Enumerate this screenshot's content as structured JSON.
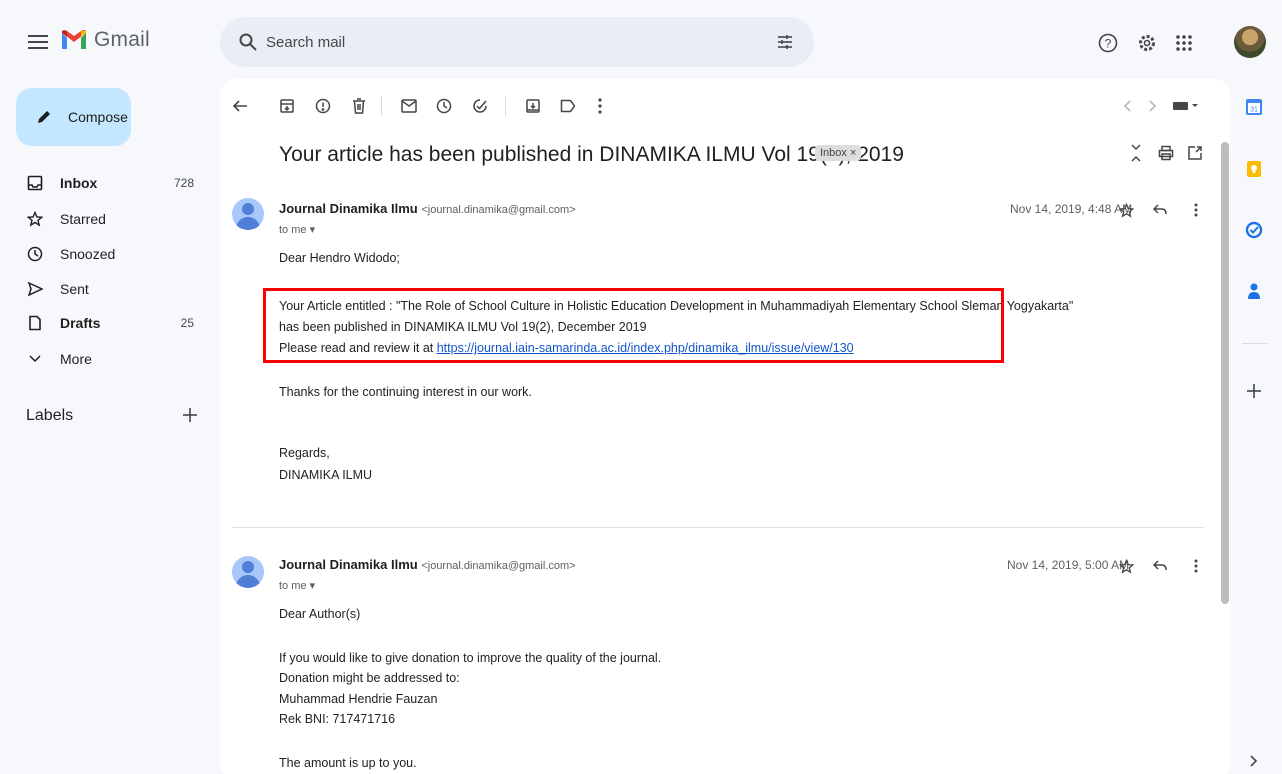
{
  "app": {
    "name": "Gmail"
  },
  "search": {
    "placeholder": "Search mail"
  },
  "compose": {
    "label": "Compose"
  },
  "sidebar": {
    "items": [
      {
        "label": "Inbox",
        "count": "728",
        "icon": "inbox-icon"
      },
      {
        "label": "Starred",
        "count": "",
        "icon": "star-icon"
      },
      {
        "label": "Snoozed",
        "count": "",
        "icon": "clock-icon"
      },
      {
        "label": "Sent",
        "count": "",
        "icon": "send-icon"
      },
      {
        "label": "Drafts",
        "count": "25",
        "icon": "file-icon"
      },
      {
        "label": "More",
        "count": "",
        "icon": "chevron-down-icon"
      }
    ],
    "labels_title": "Labels"
  },
  "thread": {
    "subject": "Your article has been published in DINAMIKA ILMU Vol 19(2), 2019",
    "label_chip": "Inbox ×"
  },
  "messages": [
    {
      "sender_name": "Journal Dinamika Ilmu",
      "sender_email": "<journal.dinamika@gmail.com>",
      "to": "to me ▾",
      "date": "Nov 14, 2019, 4:48 AM",
      "greeting": "Dear Hendro Widodo;",
      "line1": "Your Article entitled : \"The Role of School Culture in Holistic Education Development in Muhammadiyah Elementary School Sleman Yogyakarta\"",
      "line2": "has been published in DINAMIKA ILMU Vol 19(2), December 2019",
      "line3_prefix": "Please read and review it at ",
      "link": "https://journal.iain-samarinda.ac.id/index.php/dinamika_ilmu/issue/view/130",
      "thanks": "Thanks for the continuing interest in our work.",
      "regards": "Regards,",
      "signature": "DINAMIKA ILMU"
    },
    {
      "sender_name": "Journal Dinamika Ilmu",
      "sender_email": "<journal.dinamika@gmail.com>",
      "to": "to me ▾",
      "date": "Nov 14, 2019, 5:00 AM",
      "greeting": "Dear Author(s)",
      "line1": "If you would like to give donation to improve the quality of the journal.",
      "line2": "Donation might be addressed to:",
      "line3": "Muhammad Hendrie Fauzan",
      "line4": "Rek BNI: 717471716",
      "line5": "The amount is up to you."
    }
  ],
  "colors": {
    "compose_bg": "#c2e7ff",
    "search_bg": "#e9eef6",
    "highlight_border": "#ff0000",
    "link": "#1155cc"
  }
}
